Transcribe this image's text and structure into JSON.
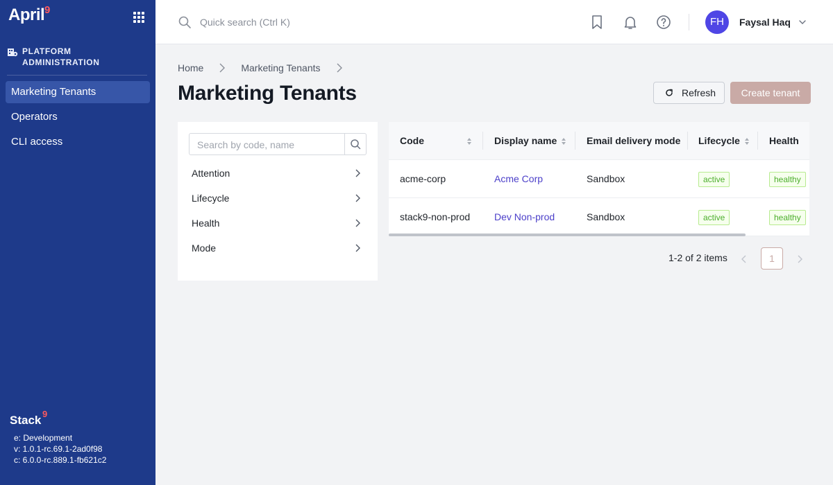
{
  "sidebar": {
    "logo": "April",
    "logo_sup": "9",
    "section_title": "PLATFORM ADMINISTRATION",
    "nav": [
      {
        "label": "Marketing Tenants",
        "active": true
      },
      {
        "label": "Operators",
        "active": false
      },
      {
        "label": "CLI access",
        "active": false
      }
    ],
    "footer_logo": "Stack",
    "footer_logo_sup": "9",
    "env_lines": [
      "e: Development",
      "v: 1.0.1-rc.69.1-2ad0f98",
      "c: 6.0.0-rc.889.1-fb621c2"
    ]
  },
  "header": {
    "search_placeholder": "Quick search (Ctrl K)",
    "user_initials": "FH",
    "user_name": "Faysal Haq"
  },
  "breadcrumb": [
    "Home",
    "Marketing Tenants"
  ],
  "page_title": "Marketing Tenants",
  "actions": {
    "refresh_label": "Refresh",
    "create_label": "Create tenant"
  },
  "filters": {
    "search_placeholder": "Search by code, name",
    "items": [
      "Attention",
      "Lifecycle",
      "Health",
      "Mode"
    ]
  },
  "table": {
    "columns": [
      "Code",
      "Display name",
      "Email delivery mode",
      "Lifecycle",
      "Health"
    ],
    "rows": [
      {
        "code": "acme-corp",
        "display_name": "Acme Corp",
        "mode": "Sandbox",
        "lifecycle": "active",
        "health": "healthy"
      },
      {
        "code": "stack9-non-prod",
        "display_name": "Dev Non-prod",
        "mode": "Sandbox",
        "lifecycle": "active",
        "health": "healthy"
      }
    ]
  },
  "pagination": {
    "summary": "1-2 of 2 items",
    "current_page": "1"
  },
  "colors": {
    "sidebar_bg": "#1e3a8a",
    "accent_disabled": "#c9aaa6",
    "link": "#4b3fc9",
    "tag_green": "#4cae2c",
    "brand_red": "#ff5a5f",
    "avatar_bg": "#4f46e5"
  },
  "icons": {
    "apps": "apps-grid-icon",
    "section": "building-icon",
    "search": "search-icon",
    "bookmark": "bookmark-icon",
    "bell": "bell-icon",
    "help": "help-icon",
    "refresh": "refresh-icon"
  }
}
